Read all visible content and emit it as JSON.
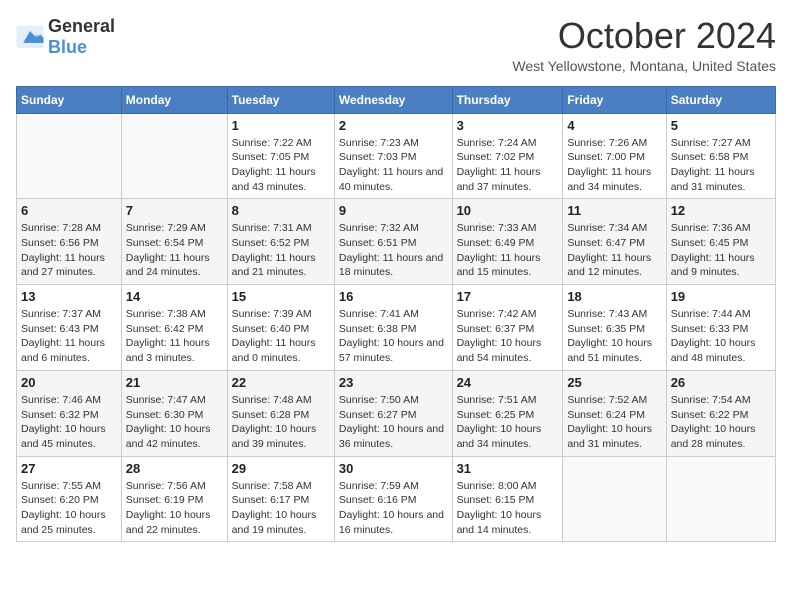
{
  "header": {
    "logo_general": "General",
    "logo_blue": "Blue",
    "title": "October 2024",
    "subtitle": "West Yellowstone, Montana, United States"
  },
  "days_of_week": [
    "Sunday",
    "Monday",
    "Tuesday",
    "Wednesday",
    "Thursday",
    "Friday",
    "Saturday"
  ],
  "weeks": [
    [
      {
        "day": "",
        "sunrise": "",
        "sunset": "",
        "daylight": "",
        "empty": true
      },
      {
        "day": "",
        "sunrise": "",
        "sunset": "",
        "daylight": "",
        "empty": true
      },
      {
        "day": "1",
        "sunrise": "Sunrise: 7:22 AM",
        "sunset": "Sunset: 7:05 PM",
        "daylight": "Daylight: 11 hours and 43 minutes.",
        "empty": false
      },
      {
        "day": "2",
        "sunrise": "Sunrise: 7:23 AM",
        "sunset": "Sunset: 7:03 PM",
        "daylight": "Daylight: 11 hours and 40 minutes.",
        "empty": false
      },
      {
        "day": "3",
        "sunrise": "Sunrise: 7:24 AM",
        "sunset": "Sunset: 7:02 PM",
        "daylight": "Daylight: 11 hours and 37 minutes.",
        "empty": false
      },
      {
        "day": "4",
        "sunrise": "Sunrise: 7:26 AM",
        "sunset": "Sunset: 7:00 PM",
        "daylight": "Daylight: 11 hours and 34 minutes.",
        "empty": false
      },
      {
        "day": "5",
        "sunrise": "Sunrise: 7:27 AM",
        "sunset": "Sunset: 6:58 PM",
        "daylight": "Daylight: 11 hours and 31 minutes.",
        "empty": false
      }
    ],
    [
      {
        "day": "6",
        "sunrise": "Sunrise: 7:28 AM",
        "sunset": "Sunset: 6:56 PM",
        "daylight": "Daylight: 11 hours and 27 minutes.",
        "empty": false
      },
      {
        "day": "7",
        "sunrise": "Sunrise: 7:29 AM",
        "sunset": "Sunset: 6:54 PM",
        "daylight": "Daylight: 11 hours and 24 minutes.",
        "empty": false
      },
      {
        "day": "8",
        "sunrise": "Sunrise: 7:31 AM",
        "sunset": "Sunset: 6:52 PM",
        "daylight": "Daylight: 11 hours and 21 minutes.",
        "empty": false
      },
      {
        "day": "9",
        "sunrise": "Sunrise: 7:32 AM",
        "sunset": "Sunset: 6:51 PM",
        "daylight": "Daylight: 11 hours and 18 minutes.",
        "empty": false
      },
      {
        "day": "10",
        "sunrise": "Sunrise: 7:33 AM",
        "sunset": "Sunset: 6:49 PM",
        "daylight": "Daylight: 11 hours and 15 minutes.",
        "empty": false
      },
      {
        "day": "11",
        "sunrise": "Sunrise: 7:34 AM",
        "sunset": "Sunset: 6:47 PM",
        "daylight": "Daylight: 11 hours and 12 minutes.",
        "empty": false
      },
      {
        "day": "12",
        "sunrise": "Sunrise: 7:36 AM",
        "sunset": "Sunset: 6:45 PM",
        "daylight": "Daylight: 11 hours and 9 minutes.",
        "empty": false
      }
    ],
    [
      {
        "day": "13",
        "sunrise": "Sunrise: 7:37 AM",
        "sunset": "Sunset: 6:43 PM",
        "daylight": "Daylight: 11 hours and 6 minutes.",
        "empty": false
      },
      {
        "day": "14",
        "sunrise": "Sunrise: 7:38 AM",
        "sunset": "Sunset: 6:42 PM",
        "daylight": "Daylight: 11 hours and 3 minutes.",
        "empty": false
      },
      {
        "day": "15",
        "sunrise": "Sunrise: 7:39 AM",
        "sunset": "Sunset: 6:40 PM",
        "daylight": "Daylight: 11 hours and 0 minutes.",
        "empty": false
      },
      {
        "day": "16",
        "sunrise": "Sunrise: 7:41 AM",
        "sunset": "Sunset: 6:38 PM",
        "daylight": "Daylight: 10 hours and 57 minutes.",
        "empty": false
      },
      {
        "day": "17",
        "sunrise": "Sunrise: 7:42 AM",
        "sunset": "Sunset: 6:37 PM",
        "daylight": "Daylight: 10 hours and 54 minutes.",
        "empty": false
      },
      {
        "day": "18",
        "sunrise": "Sunrise: 7:43 AM",
        "sunset": "Sunset: 6:35 PM",
        "daylight": "Daylight: 10 hours and 51 minutes.",
        "empty": false
      },
      {
        "day": "19",
        "sunrise": "Sunrise: 7:44 AM",
        "sunset": "Sunset: 6:33 PM",
        "daylight": "Daylight: 10 hours and 48 minutes.",
        "empty": false
      }
    ],
    [
      {
        "day": "20",
        "sunrise": "Sunrise: 7:46 AM",
        "sunset": "Sunset: 6:32 PM",
        "daylight": "Daylight: 10 hours and 45 minutes.",
        "empty": false
      },
      {
        "day": "21",
        "sunrise": "Sunrise: 7:47 AM",
        "sunset": "Sunset: 6:30 PM",
        "daylight": "Daylight: 10 hours and 42 minutes.",
        "empty": false
      },
      {
        "day": "22",
        "sunrise": "Sunrise: 7:48 AM",
        "sunset": "Sunset: 6:28 PM",
        "daylight": "Daylight: 10 hours and 39 minutes.",
        "empty": false
      },
      {
        "day": "23",
        "sunrise": "Sunrise: 7:50 AM",
        "sunset": "Sunset: 6:27 PM",
        "daylight": "Daylight: 10 hours and 36 minutes.",
        "empty": false
      },
      {
        "day": "24",
        "sunrise": "Sunrise: 7:51 AM",
        "sunset": "Sunset: 6:25 PM",
        "daylight": "Daylight: 10 hours and 34 minutes.",
        "empty": false
      },
      {
        "day": "25",
        "sunrise": "Sunrise: 7:52 AM",
        "sunset": "Sunset: 6:24 PM",
        "daylight": "Daylight: 10 hours and 31 minutes.",
        "empty": false
      },
      {
        "day": "26",
        "sunrise": "Sunrise: 7:54 AM",
        "sunset": "Sunset: 6:22 PM",
        "daylight": "Daylight: 10 hours and 28 minutes.",
        "empty": false
      }
    ],
    [
      {
        "day": "27",
        "sunrise": "Sunrise: 7:55 AM",
        "sunset": "Sunset: 6:20 PM",
        "daylight": "Daylight: 10 hours and 25 minutes.",
        "empty": false
      },
      {
        "day": "28",
        "sunrise": "Sunrise: 7:56 AM",
        "sunset": "Sunset: 6:19 PM",
        "daylight": "Daylight: 10 hours and 22 minutes.",
        "empty": false
      },
      {
        "day": "29",
        "sunrise": "Sunrise: 7:58 AM",
        "sunset": "Sunset: 6:17 PM",
        "daylight": "Daylight: 10 hours and 19 minutes.",
        "empty": false
      },
      {
        "day": "30",
        "sunrise": "Sunrise: 7:59 AM",
        "sunset": "Sunset: 6:16 PM",
        "daylight": "Daylight: 10 hours and 16 minutes.",
        "empty": false
      },
      {
        "day": "31",
        "sunrise": "Sunrise: 8:00 AM",
        "sunset": "Sunset: 6:15 PM",
        "daylight": "Daylight: 10 hours and 14 minutes.",
        "empty": false
      },
      {
        "day": "",
        "sunrise": "",
        "sunset": "",
        "daylight": "",
        "empty": true
      },
      {
        "day": "",
        "sunrise": "",
        "sunset": "",
        "daylight": "",
        "empty": true
      }
    ]
  ]
}
